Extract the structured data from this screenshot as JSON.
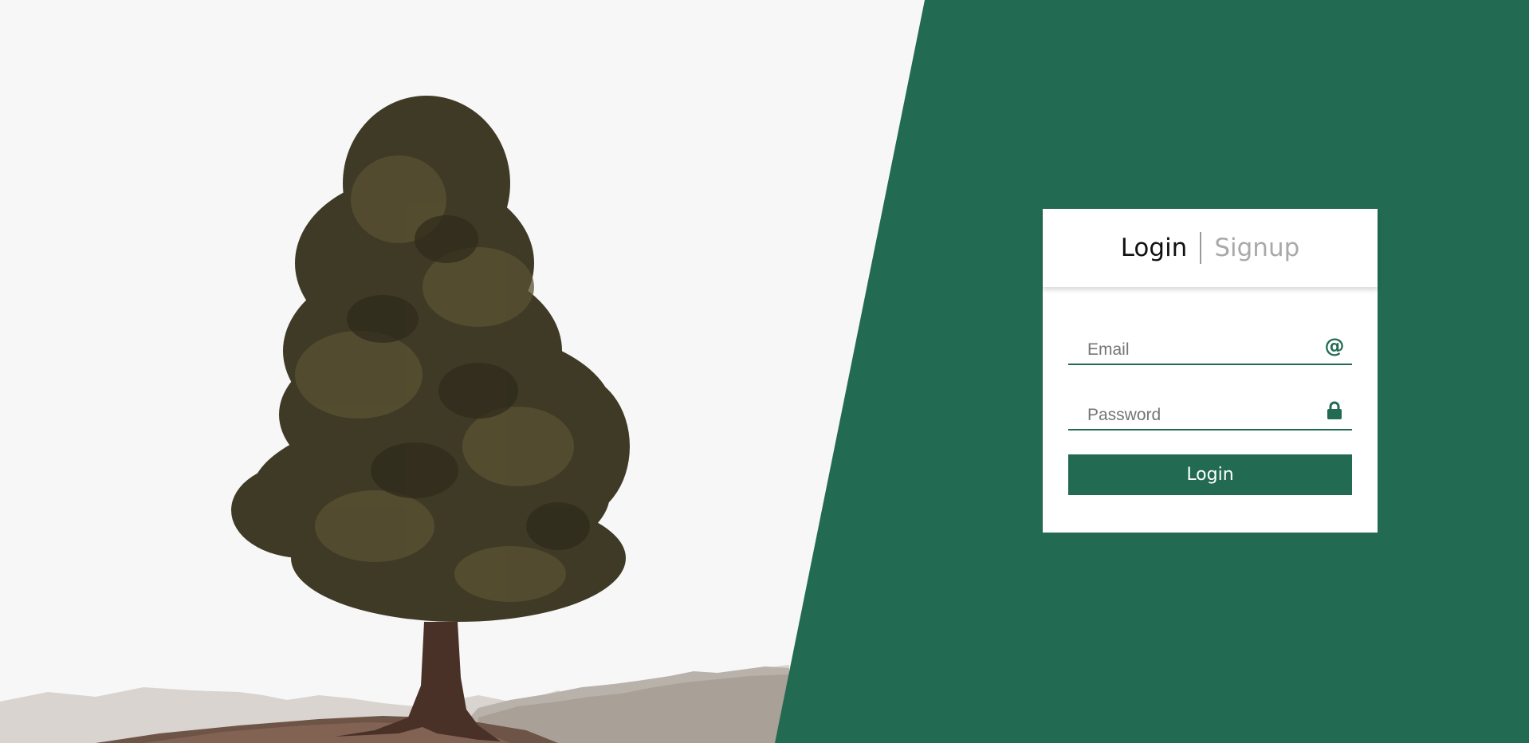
{
  "colors": {
    "accent": "#236a52",
    "background": "#f7f7f7",
    "card": "#ffffff",
    "tab_active": "#111111",
    "tab_inactive": "#a9a9a9"
  },
  "hero": {
    "image_description": "lone pine tree on a snowy hillside"
  },
  "auth_card": {
    "tabs": [
      {
        "label": "Login",
        "active": true
      },
      {
        "label": "Signup",
        "active": false
      }
    ],
    "email": {
      "placeholder": "Email",
      "value": "",
      "icon": "at-sign-icon"
    },
    "password": {
      "placeholder": "Password",
      "value": "",
      "icon": "lock-icon"
    },
    "submit_label": "Login"
  }
}
